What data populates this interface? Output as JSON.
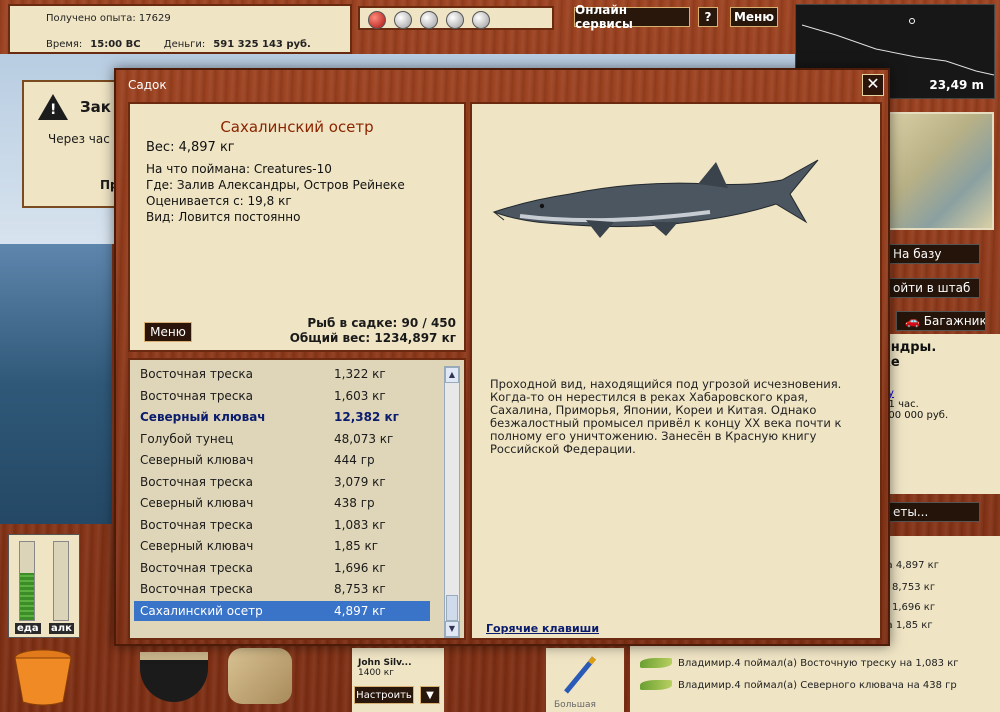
{
  "stats": {
    "experience_label": "Получено опыта:",
    "experience_value": "17629",
    "time_label": "Время:",
    "time_value": "15:00 ВС",
    "money_label": "Деньги:",
    "money_value": "591 325 143 руб."
  },
  "top_buttons": {
    "online": "Онлайн сервисы",
    "help": "?",
    "menu": "Меню"
  },
  "depth": {
    "value": "23,49 m"
  },
  "notice": {
    "title": "Зак",
    "line1": "Через час",
    "line2": "Пр"
  },
  "right": {
    "to_base": "На базу",
    "to_hq": "ойти в штаб",
    "trunk": "Багажник",
    "area_name": "андры.",
    "area_line2": "ке",
    "info1": ": 1 час.",
    "info2": "000 000 руб.",
    "info3": "4",
    "tickets": "еты..."
  },
  "feed": {
    "partial": [
      "на 4,897 кг",
      "8,753 кг",
      "1,696 кг",
      "на 1,85 кг"
    ],
    "lines": [
      "Владимир.4 поймал(а) Восточную треску на 1,083 кг",
      "Владимир.4 поймал(а) Северного клювача на 438 гр"
    ]
  },
  "gauges": {
    "food": "еда",
    "alcohol": "алк",
    "food_level": 0.6,
    "alcohol_level": 0.0
  },
  "inventory": {
    "card1_name": "John Silv...",
    "card1_weight": "1400 кг",
    "configure": "Настроить",
    "dropdown": "▼",
    "card2_label": "Большая"
  },
  "modal": {
    "title": "Садок",
    "close": "✕",
    "fish_name": "Сахалинский осетр",
    "weight_label": "Вес:",
    "weight_value": "4,897 кг",
    "caught_with_label": "На что поймана:",
    "caught_with_value": "Creatures-10",
    "where_label": "Где:",
    "where_value": "Залив Александры, Остров Рейнеке",
    "valued_label": "Оценивается с:",
    "valued_value": "19,8 кг",
    "kind_label": "Вид:",
    "kind_value": "Ловится постоянно",
    "menu_button": "Меню",
    "cage_label": "Рыб в садке:",
    "cage_value": "90 / 450",
    "total_label": "Общий вес:",
    "total_value": "1234,897 кг",
    "description": "Проходной вид, находящийся под угрозой исчезновения. Когда-то он нерестился в реках Хабаровского края, Сахалина, Приморья, Японии, Кореи и Китая. Однако безжалостный промысел привёл к концу XX века почти к полному его уничтожению. Занесён в Красную книгу Российской Федерации.",
    "hotkeys": "Горячие клавиши"
  },
  "catch_list": [
    {
      "name": "Восточная треска",
      "weight": "1,322 кг"
    },
    {
      "name": "Восточная треска",
      "weight": "1,603 кг"
    },
    {
      "name": "Северный клювач",
      "weight": "12,382 кг"
    },
    {
      "name": "Голубой тунец",
      "weight": "48,073 кг"
    },
    {
      "name": "Северный клювач",
      "weight": "444 гр"
    },
    {
      "name": "Восточная треска",
      "weight": "3,079 кг"
    },
    {
      "name": "Северный клювач",
      "weight": "438 гр"
    },
    {
      "name": "Восточная треска",
      "weight": "1,083 кг"
    },
    {
      "name": "Северный клювач",
      "weight": "1,85 кг"
    },
    {
      "name": "Восточная треска",
      "weight": "1,696 кг"
    },
    {
      "name": "Восточная треска",
      "weight": "8,753 кг"
    },
    {
      "name": "Сахалинский осетр",
      "weight": "4,897 кг"
    }
  ]
}
